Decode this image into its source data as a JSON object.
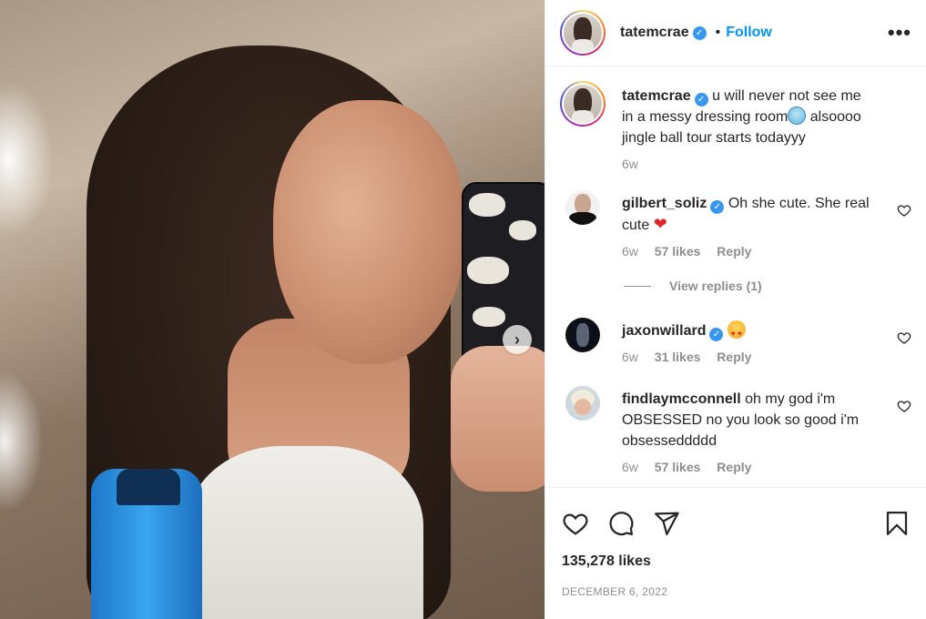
{
  "post": {
    "author": "tatemcrae",
    "follow_label": "Follow",
    "separator": "•",
    "more_label": "•••",
    "caption": {
      "username": "tatemcrae",
      "line1": "u will never not see me",
      "line2a": "in a messy dressing room",
      "line2b": " alsoooo",
      "line3": "jingle ball tour starts todayyy",
      "time": "6w"
    },
    "likes": "135,278 likes",
    "date": "DECEMBER 6, 2022"
  },
  "comments": [
    {
      "username": "gilbert_soliz",
      "text": "Oh she cute. She real",
      "text2": "cute",
      "time": "6w",
      "likes": "57 likes",
      "reply": "Reply",
      "view_replies": "View replies (1)"
    },
    {
      "username": "jaxonwillard",
      "time": "6w",
      "likes": "31 likes",
      "reply": "Reply"
    },
    {
      "username": "findlaymcconnell",
      "text": "oh my god i'm",
      "text2": "OBSESSED no you look so good i'm",
      "text3": "obsesseddddd",
      "time": "6w",
      "likes": "57 likes",
      "reply": "Reply"
    }
  ],
  "icons": {
    "verified": "verified-badge",
    "like": "heart-icon",
    "comment": "comment-icon",
    "share": "share-icon",
    "save": "bookmark-icon",
    "next": "chevron-right-icon"
  },
  "colors": {
    "accent": "#0095f6",
    "verified": "#3897f0",
    "muted": "#8e8e8e",
    "text": "#262626"
  }
}
